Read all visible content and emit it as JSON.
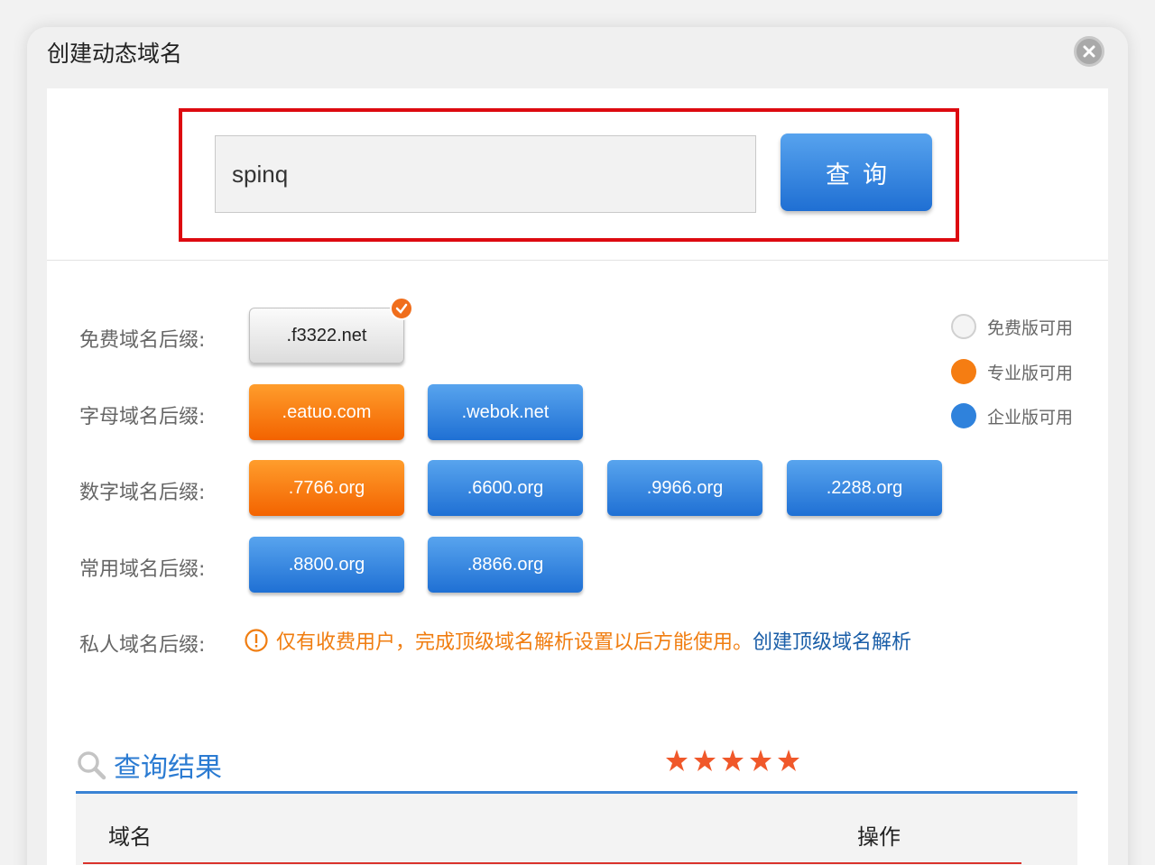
{
  "dialog": {
    "title": "创建动态域名"
  },
  "search": {
    "value": "spinq",
    "button_label": "查询"
  },
  "rows": {
    "free": {
      "label": "免费域名后缀:",
      "items": [
        ".f3322.net"
      ]
    },
    "letter": {
      "label": "字母域名后缀:",
      "items": [
        ".eatuo.com",
        ".webok.net"
      ]
    },
    "number": {
      "label": "数字域名后缀:",
      "items": [
        ".7766.org",
        ".6600.org",
        ".9966.org",
        ".2288.org"
      ]
    },
    "common": {
      "label": "常用域名后缀:",
      "items": [
        ".8800.org",
        ".8866.org"
      ]
    },
    "private": {
      "label": "私人域名后缀:",
      "note": "仅有收费用户，完成顶级域名解析设置以后方能使用。",
      "link": "创建顶级域名解析"
    }
  },
  "legend": [
    {
      "text": "免费版可用",
      "color": "#f3f3f3"
    },
    {
      "text": "专业版可用",
      "color": "#f57d12"
    },
    {
      "text": "企业版可用",
      "color": "#2f82dc"
    }
  ],
  "results": {
    "title": "查询结果",
    "columns": {
      "domain": "域名",
      "action": "操作"
    }
  },
  "colors": {
    "accent": "#2b7bd2",
    "orange": "#f57d12",
    "highlight": "#dd0a10"
  }
}
